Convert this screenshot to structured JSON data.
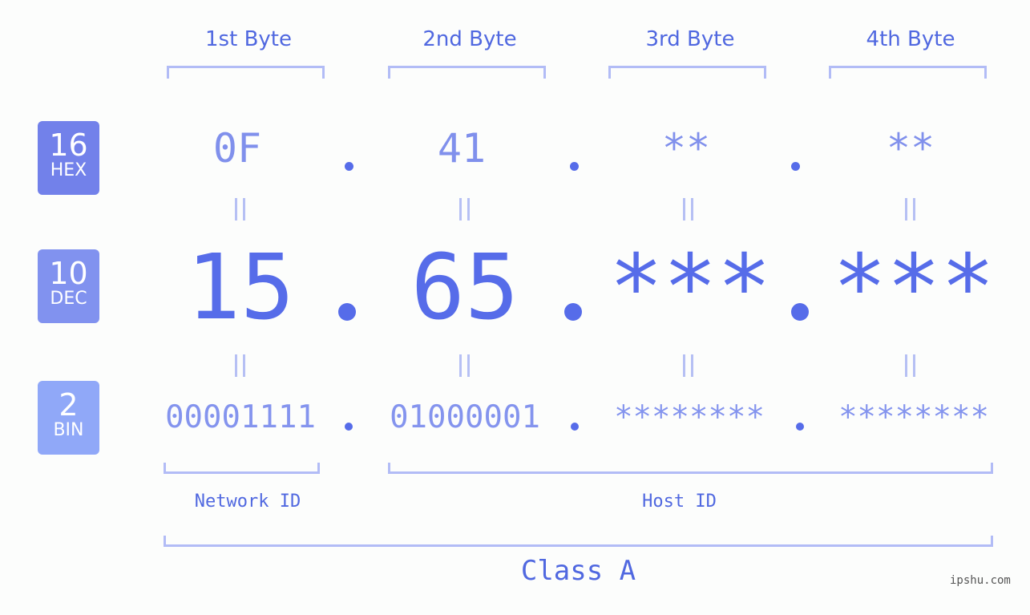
{
  "bytes": [
    {
      "header": "1st Byte",
      "hex": "0F",
      "dec": "15",
      "bin": "00001111"
    },
    {
      "header": "2nd Byte",
      "hex": "41",
      "dec": "65",
      "bin": "01000001"
    },
    {
      "header": "3rd Byte",
      "hex": "**",
      "dec": "***",
      "bin": "********"
    },
    {
      "header": "4th Byte",
      "hex": "**",
      "dec": "***",
      "bin": "********"
    }
  ],
  "bases": {
    "hex": {
      "num": "16",
      "label": "HEX",
      "color": "#7281ea"
    },
    "dec": {
      "num": "10",
      "label": "DEC",
      "color": "#8192ef"
    },
    "bin": {
      "num": "2",
      "label": "BIN",
      "color": "#90a8f8"
    }
  },
  "segments": {
    "network": "Network ID",
    "host": "Host ID",
    "class": "Class A"
  },
  "watermark": "ipshu.com",
  "colors": {
    "accent": "#566ce9",
    "bracket": "#b2bcf6"
  }
}
